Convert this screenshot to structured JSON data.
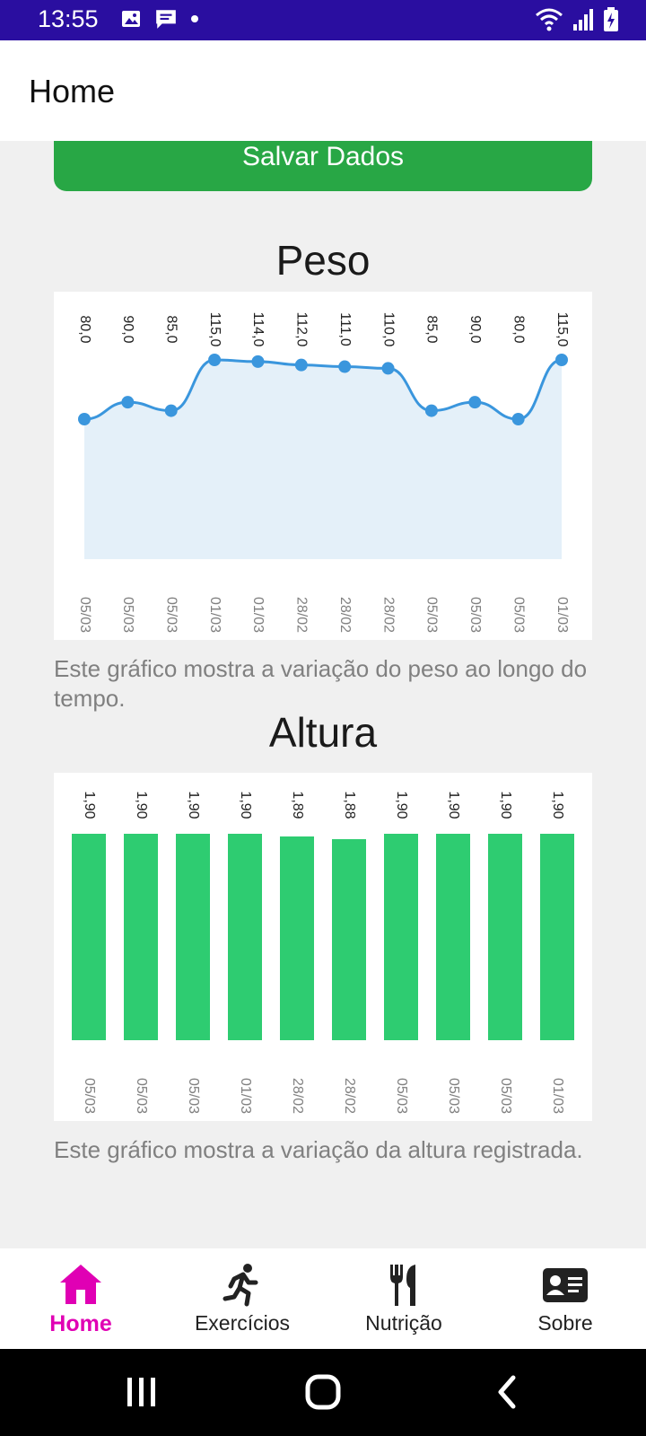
{
  "status_bar": {
    "time": "13:55",
    "left_icons": [
      "image-icon",
      "message-icon",
      "dot-icon"
    ],
    "right_icons": [
      "wifi-icon",
      "signal-icon",
      "battery-charging-icon"
    ],
    "background": "#2a0ea0"
  },
  "app_bar": {
    "title": "Home"
  },
  "save_button": {
    "label": "Salvar Dados"
  },
  "peso": {
    "title": "Peso",
    "caption": "Este gráfico mostra a variação do peso ao longo do tempo."
  },
  "altura": {
    "title": "Altura",
    "caption": "Este gráfico mostra a variação da altura registrada."
  },
  "chart_data": [
    {
      "type": "area",
      "title": "Peso",
      "categories": [
        "05/03",
        "05/03",
        "05/03",
        "01/03",
        "01/03",
        "28/02",
        "28/02",
        "28/02",
        "05/03",
        "05/03",
        "05/03",
        "01/03"
      ],
      "series": [
        {
          "values": [
            80.0,
            90.0,
            85.0,
            115.0,
            114.0,
            112.0,
            111.0,
            110.0,
            85.0,
            90.0,
            80.0,
            115.0
          ]
        }
      ],
      "value_labels": [
        "80,0",
        "90,0",
        "85,0",
        "115,0",
        "114,0",
        "112,0",
        "111,0",
        "110,0",
        "85,0",
        "90,0",
        "80,0",
        "115,0"
      ],
      "ylim": [
        0,
        115
      ],
      "color": "#3a96dd",
      "fill": "#e4f0f9",
      "grid": false
    },
    {
      "type": "bar",
      "title": "Altura",
      "categories": [
        "05/03",
        "05/03",
        "05/03",
        "01/03",
        "28/02",
        "28/02",
        "05/03",
        "05/03",
        "05/03",
        "01/03"
      ],
      "series": [
        {
          "values": [
            1.9,
            1.9,
            1.9,
            1.9,
            1.89,
            1.88,
            1.9,
            1.9,
            1.9,
            1.9
          ]
        }
      ],
      "value_labels": [
        "1,90",
        "1,90",
        "1,90",
        "1,90",
        "1,89",
        "1,88",
        "1,90",
        "1,90",
        "1,90",
        "1,90"
      ],
      "ylim": [
        0,
        1.9
      ],
      "color": "#2ecc71",
      "grid": false
    }
  ],
  "bottom_nav": {
    "active_color": "#e000b4",
    "items": [
      {
        "label": "Home",
        "icon": "home-icon"
      },
      {
        "label": "Exercícios",
        "icon": "running-icon"
      },
      {
        "label": "Nutrição",
        "icon": "fork-knife-icon"
      },
      {
        "label": "Sobre",
        "icon": "contact-card-icon"
      }
    ]
  },
  "system_nav": {
    "icons": [
      "recents-icon",
      "home-circle-icon",
      "back-icon"
    ]
  }
}
